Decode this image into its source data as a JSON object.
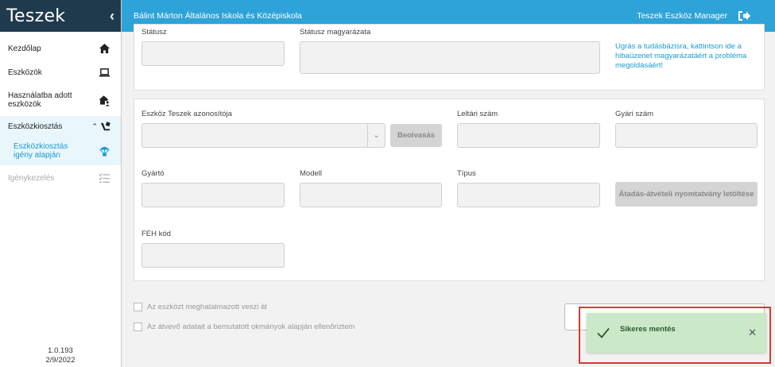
{
  "sidebar": {
    "brand": "Teszek",
    "items": [
      {
        "label": "Kezdőlap"
      },
      {
        "label": "Eszközök"
      },
      {
        "label": "Használatba adott eszközök"
      },
      {
        "label": "Eszközkiosztás"
      },
      {
        "label": "Eszközkiosztás igény alapján"
      },
      {
        "label": "Igénykezelés"
      }
    ],
    "version": "1.0.193",
    "date": "2/9/2022"
  },
  "topbar": {
    "school": "Bálint Márton Általános Iskola és Középiskola",
    "app": "Teszek Eszköz Manager"
  },
  "form": {
    "status_label": "Státusz",
    "status_desc_label": "Státusz magyarázata",
    "kb_link": "Ugrás a tudásbázisra, kattintson ide a hibaüzenet magyarázatáért a probléma megoldásáért!",
    "device_id_label": "Eszköz Teszek azonosítója",
    "scan_button": "Beolvasás",
    "inventory_label": "Leltári szám",
    "serial_label": "Gyári szám",
    "manufacturer_label": "Gyártó",
    "model_label": "Modell",
    "type_label": "Típus",
    "download_button": "Átadás-átvételi nyomtatvány letöltése",
    "feh_label": "FEH kód",
    "check1": "Az eszközt meghatalmazott veszi át",
    "check2": "Az átvevő adatait a bemutatott okmányok alapján ellenőriztem"
  },
  "toast": {
    "message": "Sikeres mentés"
  },
  "colors": {
    "sidebar_header": "#1f3a4d",
    "topbar": "#2ea3d8",
    "accent": "#1a9bd1",
    "toast_bg": "#cbe8c8",
    "highlight_border": "#d43a2f"
  }
}
